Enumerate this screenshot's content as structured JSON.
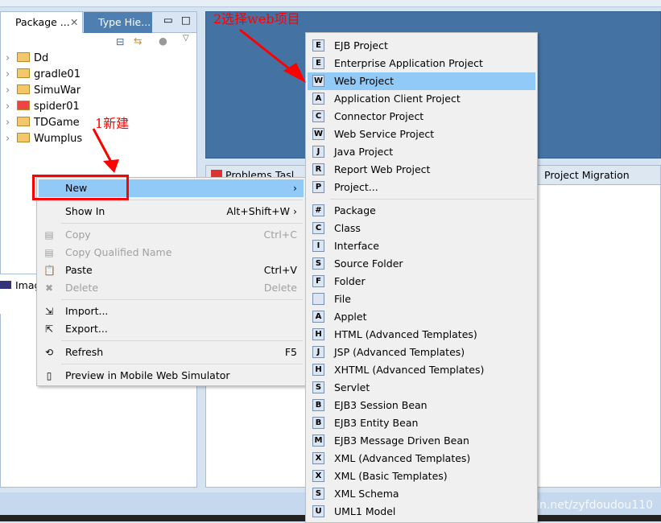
{
  "package_explorer": {
    "tab_label": "Package ...",
    "tab2_label": "Type Hie...",
    "projects": [
      {
        "name": "Dd",
        "error": false
      },
      {
        "name": "gradle01",
        "error": false
      },
      {
        "name": "SimuWar",
        "error": false
      },
      {
        "name": "spider01",
        "error": true
      },
      {
        "name": "TDGame",
        "error": false
      },
      {
        "name": "Wumplus",
        "error": false
      }
    ]
  },
  "lower_left": {
    "label": "Imag"
  },
  "bottom_tabs": {
    "problems": "Problems",
    "tasks": "Tasl",
    "migration": "Project Migration"
  },
  "context_menu": [
    {
      "label": "New",
      "shortcut": "",
      "arrow": "›",
      "highlight": true,
      "icon": ""
    },
    {
      "sep": true
    },
    {
      "label": "Show In",
      "shortcut": "Alt+Shift+W ›",
      "icon": ""
    },
    {
      "sep": true
    },
    {
      "label": "Copy",
      "shortcut": "Ctrl+C",
      "disabled": true,
      "icon": "copy-icon"
    },
    {
      "label": "Copy Qualified Name",
      "shortcut": "",
      "disabled": true,
      "icon": "copy-qualified-icon"
    },
    {
      "label": "Paste",
      "shortcut": "Ctrl+V",
      "icon": "paste-icon"
    },
    {
      "label": "Delete",
      "shortcut": "Delete",
      "disabled": true,
      "icon": "delete-icon"
    },
    {
      "sep": true
    },
    {
      "label": "Import...",
      "shortcut": "",
      "icon": "import-icon"
    },
    {
      "label": "Export...",
      "shortcut": "",
      "icon": "export-icon"
    },
    {
      "sep": true
    },
    {
      "label": "Refresh",
      "shortcut": "F5",
      "icon": "refresh-icon"
    },
    {
      "sep": true
    },
    {
      "label": "Preview in Mobile Web Simulator",
      "shortcut": "",
      "icon": "mobile-icon"
    }
  ],
  "submenu": [
    {
      "label": "EJB Project",
      "g": "E"
    },
    {
      "label": "Enterprise Application Project",
      "g": "E"
    },
    {
      "label": "Web Project",
      "g": "W",
      "highlight": true
    },
    {
      "label": "Application Client Project",
      "g": "A"
    },
    {
      "label": "Connector Project",
      "g": "C"
    },
    {
      "label": "Web Service Project",
      "g": "W"
    },
    {
      "label": "Java Project",
      "g": "J"
    },
    {
      "label": "Report Web Project",
      "g": "R"
    },
    {
      "label": "Project...",
      "g": "P"
    },
    {
      "sep": true
    },
    {
      "label": "Package",
      "g": "#"
    },
    {
      "label": "Class",
      "g": "C"
    },
    {
      "label": "Interface",
      "g": "I"
    },
    {
      "label": "Source Folder",
      "g": "S"
    },
    {
      "label": "Folder",
      "g": "F"
    },
    {
      "label": "File",
      "g": ""
    },
    {
      "label": "Applet",
      "g": "A"
    },
    {
      "label": "HTML (Advanced Templates)",
      "g": "H"
    },
    {
      "label": "JSP (Advanced Templates)",
      "g": "J"
    },
    {
      "label": "XHTML (Advanced Templates)",
      "g": "H"
    },
    {
      "label": "Servlet",
      "g": "S"
    },
    {
      "label": "EJB3 Session Bean",
      "g": "B"
    },
    {
      "label": "EJB3 Entity Bean",
      "g": "B"
    },
    {
      "label": "EJB3 Message Driven Bean",
      "g": "M"
    },
    {
      "label": "XML (Advanced Templates)",
      "g": "X"
    },
    {
      "label": "XML (Basic Templates)",
      "g": "X"
    },
    {
      "label": "XML Schema",
      "g": "S"
    },
    {
      "label": "UML1 Model",
      "g": "U"
    }
  ],
  "annotations": {
    "step1": "1新建",
    "step2": "2选择web项目"
  },
  "watermark": "https://blog.csdn.net/zyfdoudou110",
  "colors": {
    "highlight": "#91c9f7",
    "annotation": "#ff0000",
    "editor": "#4472a2"
  }
}
